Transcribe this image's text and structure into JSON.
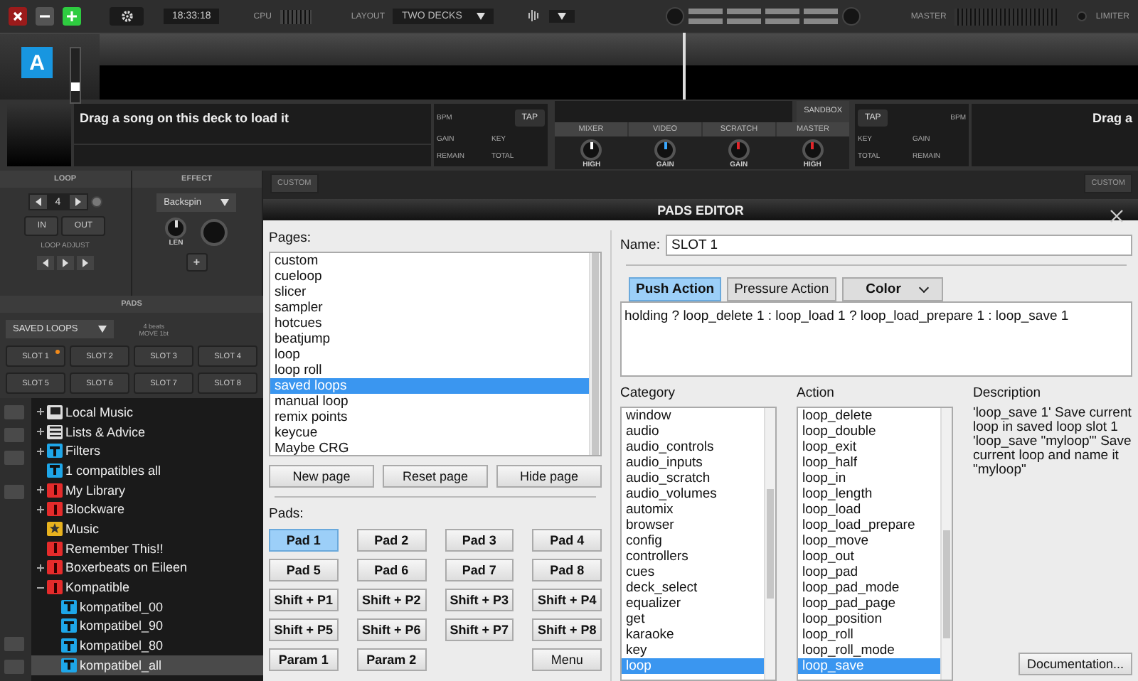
{
  "topbar": {
    "clock": "18:33:18",
    "cpu_label": "CPU",
    "layout_label": "LAYOUT",
    "layout_value": "TWO DECKS",
    "master_label": "MASTER",
    "limiter_label": "LIMITER"
  },
  "deck_strip": {
    "deck_letter": "A",
    "slider": {
      "level": 0.25
    }
  },
  "left_deck": {
    "message": "Drag a song on this deck to load it",
    "bpm_label": "BPM",
    "tap": "TAP",
    "gain_label": "GAIN",
    "key_label": "KEY",
    "remain_label": "REMAIN",
    "total_label": "TOTAL",
    "custom": "CUSTOM"
  },
  "mixer": {
    "sandbox": "SANDBOX",
    "tabs": [
      {
        "label": "MIXER",
        "selected": false
      },
      {
        "label": "VIDEO",
        "selected": false
      },
      {
        "label": "SCRATCH",
        "selected": false
      },
      {
        "label": "MASTER",
        "selected": false
      }
    ],
    "knobs": [
      {
        "label": "HIGH",
        "color": "#ffffff"
      },
      {
        "label": "GAIN",
        "color": "#3aa8ff"
      },
      {
        "label": "GAIN",
        "color": "#e0262b"
      },
      {
        "label": "HIGH",
        "color": "#e0262b"
      }
    ]
  },
  "right_deck": {
    "tap": "TAP",
    "bpm_label": "BPM",
    "key_label": "KEY",
    "gain_label": "GAIN",
    "total_label": "TOTAL",
    "remain_label": "REMAIN",
    "message": "Drag a",
    "custom": "CUSTOM"
  },
  "loop": {
    "header": "LOOP",
    "length": "4",
    "in": "IN",
    "out": "OUT",
    "adjust_label": "LOOP ADJUST"
  },
  "effect": {
    "header": "EFFECT",
    "name": "Backspin",
    "knob_label": "LEN",
    "add": "+"
  },
  "pads": {
    "header": "PADS",
    "mode": "SAVED LOOPS",
    "info": [
      "4 beats",
      "MOVE 1bt"
    ],
    "slots": [
      {
        "label": "SLOT 1",
        "marked": true
      },
      {
        "label": "SLOT 2",
        "marked": false
      },
      {
        "label": "SLOT 3",
        "marked": false
      },
      {
        "label": "SLOT 4",
        "marked": false
      },
      {
        "label": "SLOT 5",
        "marked": false
      },
      {
        "label": "SLOT 6",
        "marked": false
      },
      {
        "label": "SLOT 7",
        "marked": false
      },
      {
        "label": "SLOT 8",
        "marked": false
      }
    ]
  },
  "browser": {
    "tree": [
      {
        "label": "Local Music",
        "kind": "computer",
        "expanded": false,
        "selected": false
      },
      {
        "label": "Lists & Advice",
        "kind": "list",
        "expanded": false,
        "selected": false
      },
      {
        "label": "Filters",
        "kind": "filter",
        "expanded": false,
        "selected": false
      },
      {
        "label": "1 compatibles all",
        "kind": "filter",
        "selected": false
      },
      {
        "label": "My Library",
        "kind": "folder",
        "expanded": false,
        "selected": false
      },
      {
        "label": "Blockware",
        "kind": "folder",
        "expanded": false,
        "selected": false
      },
      {
        "label": "Music",
        "kind": "star",
        "selected": false
      },
      {
        "label": "Remember This!!",
        "kind": "folder",
        "selected": false
      },
      {
        "label": "Boxerbeats on Eileen",
        "kind": "folder",
        "expanded": false,
        "selected": false
      },
      {
        "label": "Kompatible",
        "kind": "folder",
        "expanded": true,
        "selected": false,
        "children": [
          {
            "label": "kompatibel_00",
            "kind": "filter",
            "selected": false
          },
          {
            "label": "kompatibel_90",
            "kind": "filter",
            "selected": false
          },
          {
            "label": "kompatibel_80",
            "kind": "filter",
            "selected": false
          },
          {
            "label": "kompatibel_all",
            "kind": "filter",
            "selected": true
          }
        ]
      }
    ]
  },
  "pads_editor": {
    "title": "PADS EDITOR",
    "pages_label": "Pages:",
    "pages": [
      {
        "label": "custom",
        "selected": false
      },
      {
        "label": "cueloop",
        "selected": false
      },
      {
        "label": "slicer",
        "selected": false
      },
      {
        "label": "sampler",
        "selected": false
      },
      {
        "label": "hotcues",
        "selected": false
      },
      {
        "label": "beatjump",
        "selected": false
      },
      {
        "label": "loop",
        "selected": false
      },
      {
        "label": "loop roll",
        "selected": false
      },
      {
        "label": "saved loops",
        "selected": true
      },
      {
        "label": "manual loop",
        "selected": false
      },
      {
        "label": "remix points",
        "selected": false
      },
      {
        "label": "keycue",
        "selected": false
      },
      {
        "label": "Maybe CRG",
        "selected": false
      }
    ],
    "page_buttons": [
      "New page",
      "Reset page",
      "Hide page"
    ],
    "pads_label": "Pads:",
    "pads": [
      {
        "label": "Pad 1",
        "kind": "pad",
        "selected": true
      },
      {
        "label": "Pad 2",
        "kind": "pad",
        "selected": false
      },
      {
        "label": "Pad 3",
        "kind": "pad",
        "selected": false
      },
      {
        "label": "Pad 4",
        "kind": "pad",
        "selected": false
      },
      {
        "label": "Pad 5",
        "kind": "pad",
        "selected": false
      },
      {
        "label": "Pad 6",
        "kind": "pad",
        "selected": false
      },
      {
        "label": "Pad 7",
        "kind": "pad",
        "selected": false
      },
      {
        "label": "Pad 8",
        "kind": "pad",
        "selected": false
      },
      {
        "label": "Shift + P1",
        "kind": "pad",
        "selected": false
      },
      {
        "label": "Shift + P2",
        "kind": "pad",
        "selected": false
      },
      {
        "label": "Shift + P3",
        "kind": "pad",
        "selected": false
      },
      {
        "label": "Shift + P4",
        "kind": "pad",
        "selected": false
      },
      {
        "label": "Shift + P5",
        "kind": "pad",
        "selected": false
      },
      {
        "label": "Shift + P6",
        "kind": "pad",
        "selected": false
      },
      {
        "label": "Shift + P7",
        "kind": "pad",
        "selected": false
      },
      {
        "label": "Shift + P8",
        "kind": "pad",
        "selected": false
      },
      {
        "label": "Param 1",
        "kind": "pad",
        "selected": false
      },
      {
        "label": "Param 2",
        "kind": "pad",
        "selected": false
      },
      {
        "label": "Menu",
        "kind": "menu",
        "selected": false
      }
    ],
    "name_label": "Name:",
    "name_value": "SLOT 1",
    "action_tabs": [
      {
        "label": "Push Action",
        "kind": "tab",
        "selected": true
      },
      {
        "label": "Pressure Action",
        "kind": "tab",
        "selected": false
      },
      {
        "label": "Color",
        "kind": "dropdown"
      }
    ],
    "script": "holding ? loop_delete 1 : loop_load 1 ? loop_load_prepare 1 : loop_save 1",
    "category_label": "Category",
    "categories": [
      {
        "label": "window",
        "selected": false
      },
      {
        "label": "audio",
        "selected": false
      },
      {
        "label": "audio_controls",
        "selected": false
      },
      {
        "label": "audio_inputs",
        "selected": false
      },
      {
        "label": "audio_scratch",
        "selected": false
      },
      {
        "label": "audio_volumes",
        "selected": false
      },
      {
        "label": "automix",
        "selected": false
      },
      {
        "label": "browser",
        "selected": false
      },
      {
        "label": "config",
        "selected": false
      },
      {
        "label": "controllers",
        "selected": false
      },
      {
        "label": "cues",
        "selected": false
      },
      {
        "label": "deck_select",
        "selected": false
      },
      {
        "label": "equalizer",
        "selected": false
      },
      {
        "label": "get",
        "selected": false
      },
      {
        "label": "karaoke",
        "selected": false
      },
      {
        "label": "key",
        "selected": false
      },
      {
        "label": "loop",
        "selected": true
      }
    ],
    "action_label": "Action",
    "actions": [
      {
        "label": "loop_delete",
        "selected": false
      },
      {
        "label": "loop_double",
        "selected": false
      },
      {
        "label": "loop_exit",
        "selected": false
      },
      {
        "label": "loop_half",
        "selected": false
      },
      {
        "label": "loop_in",
        "selected": false
      },
      {
        "label": "loop_length",
        "selected": false
      },
      {
        "label": "loop_load",
        "selected": false
      },
      {
        "label": "loop_load_prepare",
        "selected": false
      },
      {
        "label": "loop_move",
        "selected": false
      },
      {
        "label": "loop_out",
        "selected": false
      },
      {
        "label": "loop_pad",
        "selected": false
      },
      {
        "label": "loop_pad_mode",
        "selected": false
      },
      {
        "label": "loop_pad_page",
        "selected": false
      },
      {
        "label": "loop_position",
        "selected": false
      },
      {
        "label": "loop_roll",
        "selected": false
      },
      {
        "label": "loop_roll_mode",
        "selected": false
      },
      {
        "label": "loop_save",
        "selected": true
      }
    ],
    "description_label": "Description",
    "description": "'loop_save 1' Save current loop in saved loop slot 1 'loop_save \"myloop\"' Save current loop and name it \"myloop\"",
    "documentation_button": "Documentation..."
  }
}
